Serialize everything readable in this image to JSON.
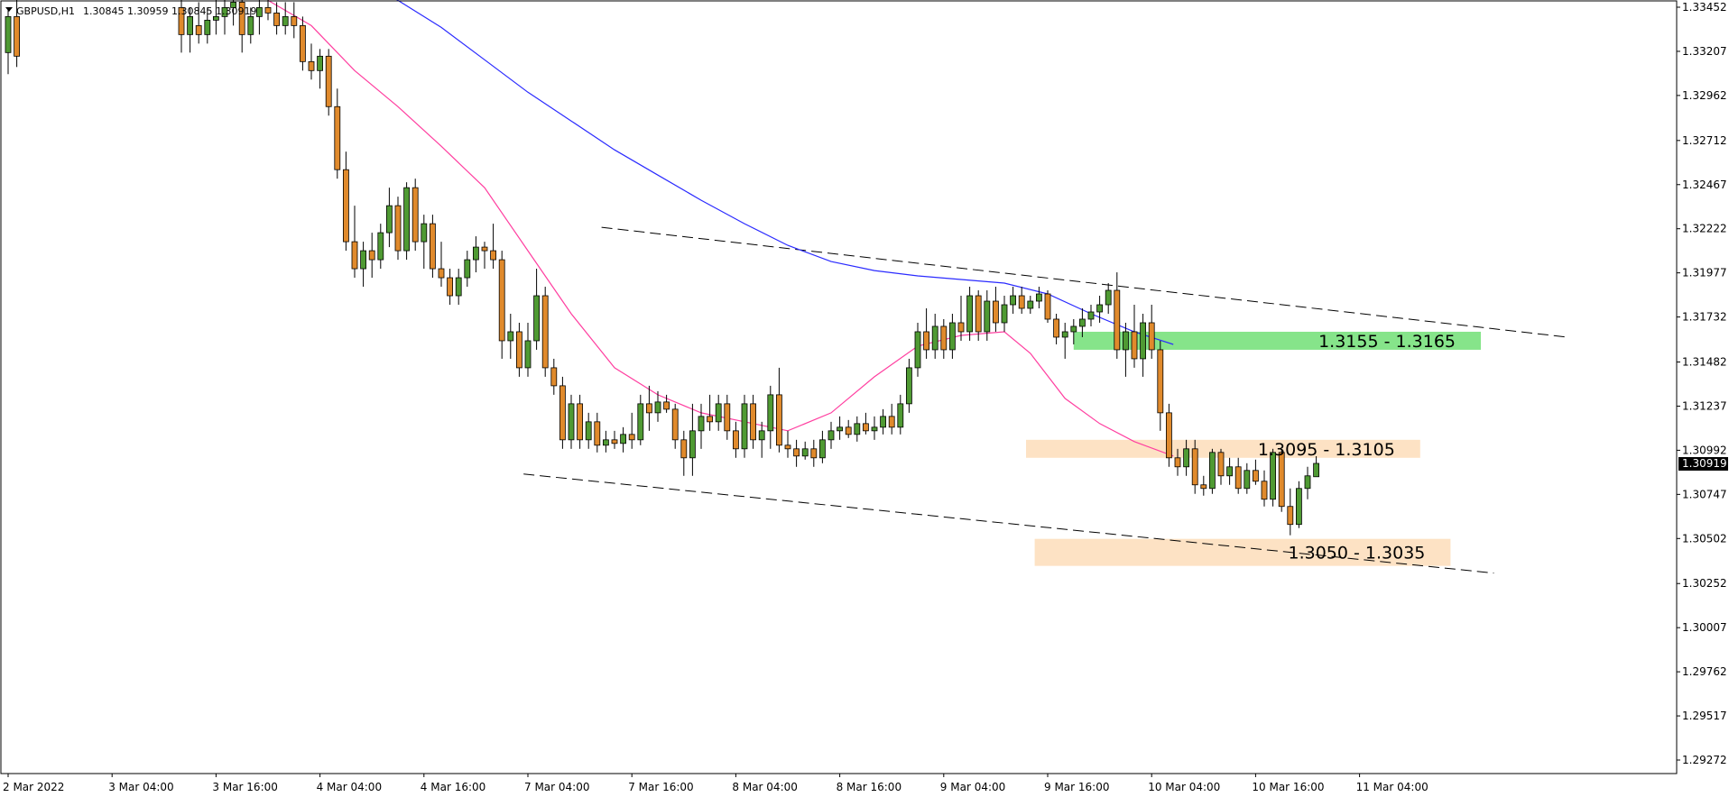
{
  "header": {
    "symbol": "GBPUSD,H1",
    "ohlc": "1.30845 1.30959 1.30845 1.30919"
  },
  "chart_data": {
    "type": "candlestick",
    "title": "",
    "xlabel": "",
    "ylabel": "",
    "ylim": [
      1.2915,
      1.33515
    ],
    "grid": false,
    "y_ticks": [
      "1.33452",
      "1.33207",
      "1.32962",
      "1.32712",
      "1.32467",
      "1.32222",
      "1.31977",
      "1.31732",
      "1.31482",
      "1.31237",
      "1.30992",
      "1.30747",
      "1.30502",
      "1.30252",
      "1.30007",
      "1.29762",
      "1.29517",
      "1.29272"
    ],
    "x_ticks": [
      "2 Mar 2022",
      "3 Mar 04:00",
      "3 Mar 16:00",
      "4 Mar 04:00",
      "4 Mar 16:00",
      "7 Mar 04:00",
      "7 Mar 16:00",
      "8 Mar 04:00",
      "8 Mar 16:00",
      "9 Mar 04:00",
      "9 Mar 16:00",
      "10 Mar 04:00",
      "10 Mar 16:00",
      "11 Mar 04:00"
    ],
    "current_price": "1.30919",
    "up_color": "#4f9a33",
    "down_color": "#e08a2c",
    "zones": [
      {
        "name": "resistance-zone-upper",
        "label": "1.3155 - 1.3165",
        "color": "#86e48a",
        "price_from": 1.3155,
        "price_to": 1.3165,
        "time_from": 123.0,
        "time_to": 170.0
      },
      {
        "name": "resistance-zone-lower",
        "label": "1.3095 - 1.3105",
        "color": "#fde2c4",
        "price_from": 1.3095,
        "price_to": 1.3105,
        "time_from": 117.5,
        "time_to": 163.0
      },
      {
        "name": "support-zone",
        "label": "1.3050 - 1.3035",
        "color": "#fde2c4",
        "price_from": 1.3035,
        "price_to": 1.305,
        "time_from": 118.5,
        "time_to": 166.5
      }
    ],
    "trendlines": [
      {
        "name": "upper-channel-line",
        "t1": 68.5,
        "p1": 1.3223,
        "t2": 180.0,
        "p2": 1.3162
      },
      {
        "name": "lower-channel-line",
        "t1": 59.5,
        "p1": 1.3086,
        "t2": 171.5,
        "p2": 1.3031
      }
    ],
    "series": [
      {
        "name": "",
        "type": "ma",
        "color": "#ff3fa0",
        "points": [
          [
            30,
            1.3349
          ],
          [
            35,
            1.3335
          ],
          [
            40,
            1.331
          ],
          [
            45,
            1.329
          ],
          [
            50,
            1.3268
          ],
          [
            55,
            1.3245
          ],
          [
            60,
            1.321
          ],
          [
            65,
            1.3175
          ],
          [
            70,
            1.3145
          ],
          [
            75,
            1.313
          ],
          [
            80,
            1.312
          ],
          [
            85,
            1.3115
          ],
          [
            90,
            1.311
          ],
          [
            95,
            1.312
          ],
          [
            100,
            1.314
          ],
          [
            105,
            1.3157
          ],
          [
            110,
            1.3163
          ],
          [
            115,
            1.3165
          ],
          [
            118,
            1.3153
          ],
          [
            122,
            1.3128
          ],
          [
            126,
            1.3114
          ],
          [
            130,
            1.3104
          ],
          [
            134.5,
            1.3096
          ]
        ]
      },
      {
        "name": "",
        "type": "ma",
        "color": "#2b2bff",
        "points": [
          [
            44,
            1.3352
          ],
          [
            50,
            1.3334
          ],
          [
            55,
            1.3316
          ],
          [
            60,
            1.3298
          ],
          [
            65,
            1.3282
          ],
          [
            70,
            1.3266
          ],
          [
            75,
            1.3252
          ],
          [
            80,
            1.3238
          ],
          [
            85,
            1.3225
          ],
          [
            90,
            1.3213
          ],
          [
            95,
            1.3204
          ],
          [
            100,
            1.3199
          ],
          [
            105,
            1.3196
          ],
          [
            110,
            1.3194
          ],
          [
            115,
            1.3192
          ],
          [
            120,
            1.3186
          ],
          [
            125,
            1.3175
          ],
          [
            130,
            1.3165
          ],
          [
            134.5,
            1.3158
          ]
        ]
      }
    ],
    "candles": [
      [
        0,
        1.332,
        1.3345,
        1.3308,
        1.334
      ],
      [
        1,
        1.334,
        1.335,
        1.3312,
        1.3318
      ],
      [
        20,
        1.3345,
        1.3352,
        1.332,
        1.333
      ],
      [
        21,
        1.333,
        1.3345,
        1.332,
        1.334
      ],
      [
        22,
        1.3335,
        1.3348,
        1.3325,
        1.333
      ],
      [
        23,
        1.333,
        1.3345,
        1.3325,
        1.3338
      ],
      [
        24,
        1.3338,
        1.335,
        1.333,
        1.334
      ],
      [
        25,
        1.334,
        1.335,
        1.333,
        1.3345
      ],
      [
        26,
        1.3345,
        1.3352,
        1.3335,
        1.3348
      ],
      [
        27,
        1.3348,
        1.3352,
        1.332,
        1.333
      ],
      [
        28,
        1.333,
        1.3345,
        1.3325,
        1.334
      ],
      [
        29,
        1.334,
        1.3352,
        1.333,
        1.3345
      ],
      [
        30,
        1.3345,
        1.335,
        1.3338,
        1.3342
      ],
      [
        31,
        1.3342,
        1.3348,
        1.333,
        1.3335
      ],
      [
        32,
        1.3335,
        1.3348,
        1.333,
        1.334
      ],
      [
        33,
        1.334,
        1.3348,
        1.3328,
        1.3335
      ],
      [
        34,
        1.3335,
        1.334,
        1.331,
        1.3315
      ],
      [
        35,
        1.3315,
        1.3325,
        1.3305,
        1.331
      ],
      [
        36,
        1.331,
        1.3322,
        1.33,
        1.3318
      ],
      [
        37,
        1.3318,
        1.3322,
        1.3285,
        1.329
      ],
      [
        38,
        1.329,
        1.33,
        1.325,
        1.3255
      ],
      [
        39,
        1.3255,
        1.3265,
        1.321,
        1.3215
      ],
      [
        40,
        1.3215,
        1.3235,
        1.3195,
        1.32
      ],
      [
        41,
        1.32,
        1.3215,
        1.319,
        1.321
      ],
      [
        42,
        1.321,
        1.322,
        1.3195,
        1.3205
      ],
      [
        43,
        1.3205,
        1.3225,
        1.32,
        1.322
      ],
      [
        44,
        1.322,
        1.3245,
        1.3212,
        1.3235
      ],
      [
        45,
        1.3235,
        1.324,
        1.3205,
        1.321
      ],
      [
        46,
        1.321,
        1.3248,
        1.3205,
        1.3245
      ],
      [
        47,
        1.3245,
        1.325,
        1.321,
        1.3215
      ],
      [
        48,
        1.3215,
        1.323,
        1.32,
        1.3225
      ],
      [
        49,
        1.3225,
        1.323,
        1.3195,
        1.32
      ],
      [
        50,
        1.32,
        1.3215,
        1.319,
        1.3195
      ],
      [
        51,
        1.3195,
        1.32,
        1.318,
        1.3185
      ],
      [
        52,
        1.3185,
        1.32,
        1.318,
        1.3195
      ],
      [
        53,
        1.3195,
        1.321,
        1.319,
        1.3205
      ],
      [
        54,
        1.3205,
        1.3218,
        1.3198,
        1.3212
      ],
      [
        55,
        1.3212,
        1.3215,
        1.32,
        1.321
      ],
      [
        56,
        1.321,
        1.3225,
        1.32,
        1.3205
      ],
      [
        57,
        1.3205,
        1.321,
        1.315,
        1.316
      ],
      [
        58,
        1.316,
        1.3175,
        1.315,
        1.3165
      ],
      [
        59,
        1.3165,
        1.317,
        1.314,
        1.3145
      ],
      [
        60,
        1.3145,
        1.317,
        1.314,
        1.316
      ],
      [
        61,
        1.316,
        1.32,
        1.3155,
        1.3185
      ],
      [
        62,
        1.3185,
        1.319,
        1.314,
        1.3145
      ],
      [
        63,
        1.3145,
        1.315,
        1.313,
        1.3135
      ],
      [
        64,
        1.3135,
        1.314,
        1.31,
        1.3105
      ],
      [
        65,
        1.3105,
        1.313,
        1.31,
        1.3125
      ],
      [
        66,
        1.3125,
        1.313,
        1.31,
        1.3105
      ],
      [
        67,
        1.3105,
        1.312,
        1.31,
        1.3115
      ],
      [
        68,
        1.3115,
        1.312,
        1.3098,
        1.3102
      ],
      [
        69,
        1.3102,
        1.311,
        1.3098,
        1.3105
      ],
      [
        70,
        1.3105,
        1.311,
        1.31,
        1.3103
      ],
      [
        71,
        1.3103,
        1.3112,
        1.3098,
        1.3108
      ],
      [
        72,
        1.3108,
        1.312,
        1.31,
        1.3105
      ],
      [
        73,
        1.3105,
        1.313,
        1.3102,
        1.3125
      ],
      [
        74,
        1.3125,
        1.3135,
        1.311,
        1.312
      ],
      [
        75,
        1.312,
        1.3132,
        1.3115,
        1.3126
      ],
      [
        76,
        1.3126,
        1.313,
        1.312,
        1.3122
      ],
      [
        77,
        1.3122,
        1.3125,
        1.31,
        1.3105
      ],
      [
        78,
        1.3105,
        1.311,
        1.3085,
        1.3095
      ],
      [
        79,
        1.3095,
        1.3125,
        1.3085,
        1.311
      ],
      [
        80,
        1.311,
        1.3125,
        1.31,
        1.3118
      ],
      [
        81,
        1.3118,
        1.313,
        1.311,
        1.3115
      ],
      [
        82,
        1.3115,
        1.313,
        1.311,
        1.3125
      ],
      [
        83,
        1.3125,
        1.313,
        1.3105,
        1.311
      ],
      [
        84,
        1.311,
        1.3115,
        1.3095,
        1.31
      ],
      [
        85,
        1.31,
        1.313,
        1.3095,
        1.3125
      ],
      [
        86,
        1.3125,
        1.313,
        1.31,
        1.3105
      ],
      [
        87,
        1.3105,
        1.3115,
        1.3095,
        1.311
      ],
      [
        88,
        1.311,
        1.3135,
        1.31,
        1.313
      ],
      [
        89,
        1.313,
        1.3145,
        1.3098,
        1.3102
      ],
      [
        90,
        1.3102,
        1.311,
        1.3095,
        1.31
      ],
      [
        91,
        1.31,
        1.3105,
        1.309,
        1.3096
      ],
      [
        92,
        1.3096,
        1.3104,
        1.3094,
        1.31
      ],
      [
        93,
        1.31,
        1.3105,
        1.309,
        1.3095
      ],
      [
        94,
        1.3095,
        1.311,
        1.3092,
        1.3105
      ],
      [
        95,
        1.3105,
        1.3115,
        1.31,
        1.311
      ],
      [
        96,
        1.311,
        1.3118,
        1.3105,
        1.3112
      ],
      [
        97,
        1.3112,
        1.3116,
        1.3106,
        1.3108
      ],
      [
        98,
        1.3108,
        1.3118,
        1.3104,
        1.3114
      ],
      [
        99,
        1.3114,
        1.312,
        1.3108,
        1.311
      ],
      [
        100,
        1.311,
        1.3118,
        1.3105,
        1.3112
      ],
      [
        101,
        1.3112,
        1.3122,
        1.3108,
        1.3118
      ],
      [
        102,
        1.3118,
        1.3125,
        1.3108,
        1.3112
      ],
      [
        103,
        1.3112,
        1.313,
        1.3108,
        1.3125
      ],
      [
        104,
        1.3125,
        1.315,
        1.312,
        1.3145
      ],
      [
        105,
        1.3145,
        1.317,
        1.314,
        1.3165
      ],
      [
        106,
        1.3165,
        1.3178,
        1.315,
        1.3155
      ],
      [
        107,
        1.3155,
        1.3175,
        1.315,
        1.3168
      ],
      [
        108,
        1.3168,
        1.3172,
        1.315,
        1.3155
      ],
      [
        109,
        1.3155,
        1.3175,
        1.315,
        1.317
      ],
      [
        110,
        1.317,
        1.3185,
        1.316,
        1.3165
      ],
      [
        111,
        1.3165,
        1.319,
        1.316,
        1.3185
      ],
      [
        112,
        1.3185,
        1.3188,
        1.316,
        1.3165
      ],
      [
        113,
        1.3165,
        1.3188,
        1.316,
        1.3182
      ],
      [
        114,
        1.3182,
        1.319,
        1.3165,
        1.317
      ],
      [
        115,
        1.317,
        1.3185,
        1.3165,
        1.318
      ],
      [
        116,
        1.318,
        1.319,
        1.3175,
        1.3185
      ],
      [
        117,
        1.3185,
        1.319,
        1.3175,
        1.3178
      ],
      [
        118,
        1.3178,
        1.3185,
        1.3175,
        1.3182
      ],
      [
        119,
        1.3182,
        1.319,
        1.3178,
        1.3186
      ],
      [
        120,
        1.3186,
        1.3188,
        1.317,
        1.3172
      ],
      [
        121,
        1.3172,
        1.3175,
        1.3158,
        1.3162
      ],
      [
        122,
        1.3162,
        1.317,
        1.315,
        1.3165
      ],
      [
        123,
        1.3165,
        1.3172,
        1.3158,
        1.3168
      ],
      [
        124,
        1.3168,
        1.3178,
        1.3162,
        1.3172
      ],
      [
        125,
        1.3172,
        1.318,
        1.3168,
        1.3176
      ],
      [
        126,
        1.3176,
        1.3185,
        1.317,
        1.318
      ],
      [
        127,
        1.318,
        1.3192,
        1.3175,
        1.3188
      ],
      [
        128,
        1.3188,
        1.3198,
        1.315,
        1.3155
      ],
      [
        129,
        1.3155,
        1.317,
        1.314,
        1.3165
      ],
      [
        130,
        1.3165,
        1.318,
        1.3145,
        1.315
      ],
      [
        131,
        1.315,
        1.3175,
        1.314,
        1.317
      ],
      [
        132,
        1.317,
        1.318,
        1.315,
        1.3155
      ],
      [
        133,
        1.3155,
        1.316,
        1.311,
        1.312
      ],
      [
        134,
        1.312,
        1.3125,
        1.309,
        1.3095
      ],
      [
        135,
        1.3095,
        1.31,
        1.3085,
        1.309
      ],
      [
        136,
        1.309,
        1.3105,
        1.3085,
        1.31
      ],
      [
        137,
        1.31,
        1.3105,
        1.3075,
        1.308
      ],
      [
        138,
        1.308,
        1.3085,
        1.3074,
        1.3078
      ],
      [
        139,
        1.3078,
        1.31,
        1.3075,
        1.3098
      ],
      [
        140,
        1.3098,
        1.31,
        1.308,
        1.3085
      ],
      [
        141,
        1.3085,
        1.3095,
        1.308,
        1.309
      ],
      [
        142,
        1.309,
        1.3095,
        1.3075,
        1.3078
      ],
      [
        143,
        1.3078,
        1.3092,
        1.3075,
        1.3088
      ],
      [
        144,
        1.3088,
        1.3094,
        1.308,
        1.3082
      ],
      [
        145,
        1.3082,
        1.3088,
        1.3068,
        1.3072
      ],
      [
        146,
        1.3072,
        1.31,
        1.3068,
        1.3098
      ],
      [
        147,
        1.3098,
        1.31,
        1.3065,
        1.3068
      ],
      [
        148,
        1.3068,
        1.3078,
        1.3052,
        1.3058
      ],
      [
        149,
        1.3058,
        1.3082,
        1.3056,
        1.3078
      ],
      [
        150,
        1.3078,
        1.309,
        1.3072,
        1.3085
      ],
      [
        151,
        1.30845,
        1.30959,
        1.30845,
        1.30919
      ]
    ]
  }
}
